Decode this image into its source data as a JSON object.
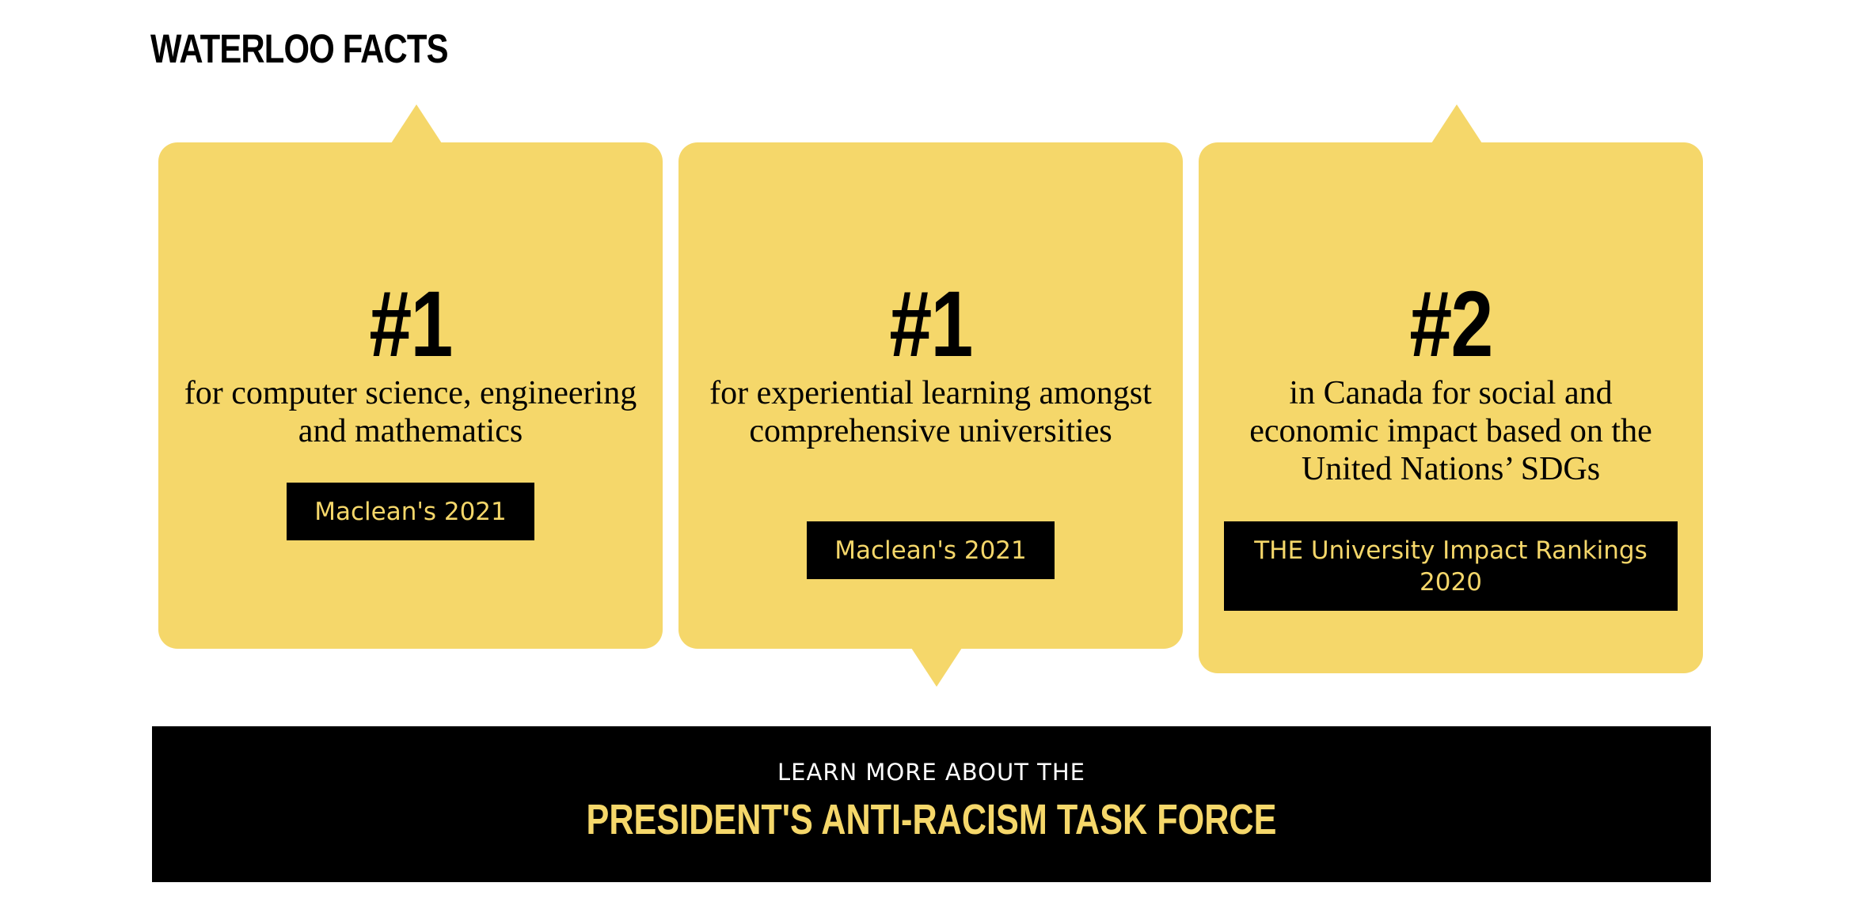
{
  "section": {
    "title": "WATERLOO FACTS"
  },
  "colors": {
    "card_background": "#f5d76a",
    "source_background": "#000000",
    "source_text": "#f5d76a",
    "cta_background": "#000000",
    "cta_kicker_text": "#ffffff",
    "cta_title_text": "#f5d76a"
  },
  "facts": [
    {
      "rank": "#1",
      "description": "for computer science, engineering and mathematics",
      "source": "Maclean's 2021"
    },
    {
      "rank": "#1",
      "description": "for experiential learning amongst comprehensive universities",
      "source": "Maclean's 2021"
    },
    {
      "rank": "#2",
      "description": "in Canada for social and economic impact based on the United Nations’ SDGs",
      "source": "THE University Impact Rankings 2020"
    }
  ],
  "cta": {
    "kicker": "LEARN MORE ABOUT THE",
    "title": "PRESIDENT'S ANTI-RACISM TASK FORCE"
  }
}
